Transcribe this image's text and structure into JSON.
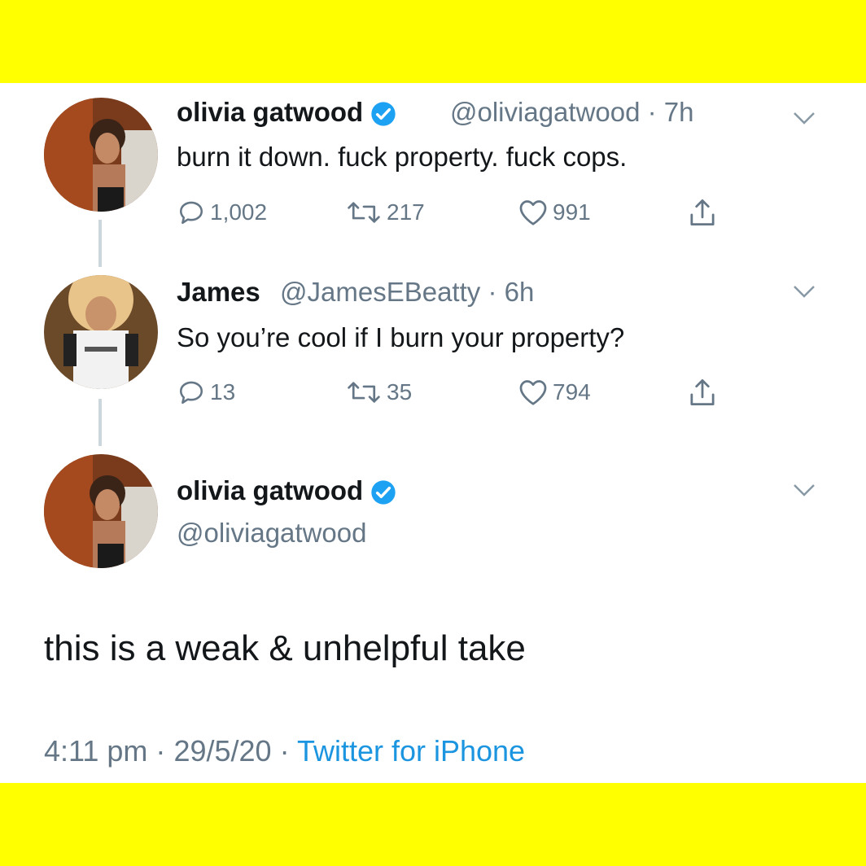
{
  "colors": {
    "frame": "#ffff00",
    "name": "#14171a",
    "muted": "#657786",
    "link": "#1b95e0",
    "verified": "#1da1f2"
  },
  "tweets": [
    {
      "name": "olivia gatwood",
      "verified": true,
      "handle": "@oliviagatwood",
      "time": "· 7h",
      "text": "burn it down. fuck property. fuck cops.",
      "replies": "1,002",
      "retweets": "217",
      "likes": "991"
    },
    {
      "name": "James",
      "verified": false,
      "handle": "@JamesEBeatty",
      "time": "· 6h",
      "text": "So you’re cool if I burn your property?",
      "replies": "13",
      "retweets": "35",
      "likes": "794"
    }
  ],
  "focus": {
    "name": "olivia gatwood",
    "verified": true,
    "handle": "@oliviagatwood",
    "text": "this is a weak & unhelpful take",
    "time": "4:11 pm",
    "date": "29/5/20",
    "source": "Twitter for iPhone",
    "separator": "·"
  }
}
